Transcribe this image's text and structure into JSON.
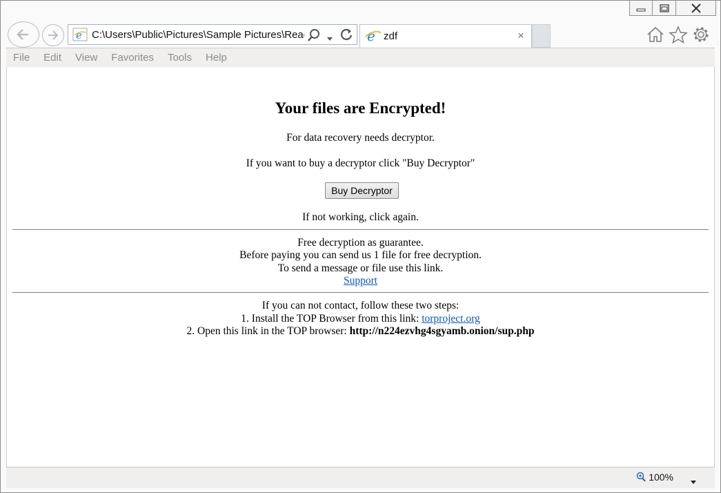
{
  "browser": {
    "address": "C:\\Users\\Public\\Pictures\\Sample Pictures\\Read",
    "tab_title": "zdf",
    "tab_close": "×",
    "menu": [
      "File",
      "Edit",
      "View",
      "Favorites",
      "Tools",
      "Help"
    ],
    "zoom": "100%"
  },
  "page": {
    "heading": "Your files are Encrypted!",
    "line1": "For data recovery needs decryptor.",
    "line2": "If you want to buy a decryptor click \"Buy Decryptor\"",
    "buy_button": "Buy Decryptor",
    "line3": "If not working, click again.",
    "free1": "Free decryption as guarantee.",
    "free2": "Before paying you can send us 1 file for free decryption.",
    "free3": "To send a message or file use this link.",
    "support_link": "Support",
    "steps_intro": "If you can not contact, follow these two steps:",
    "step1_text": "1. Install the TOP Browser from this link: ",
    "step1_link": "torproject.org",
    "step2_text": "2. Open this link in the TOP browser: ",
    "step2_url": "http://n224ezvhg4sgyamb.onion/sup.php"
  },
  "colors": {
    "link": "#0b57c4",
    "menu_text": "#8c8c8c",
    "ie_blue": "#1e88d8"
  }
}
